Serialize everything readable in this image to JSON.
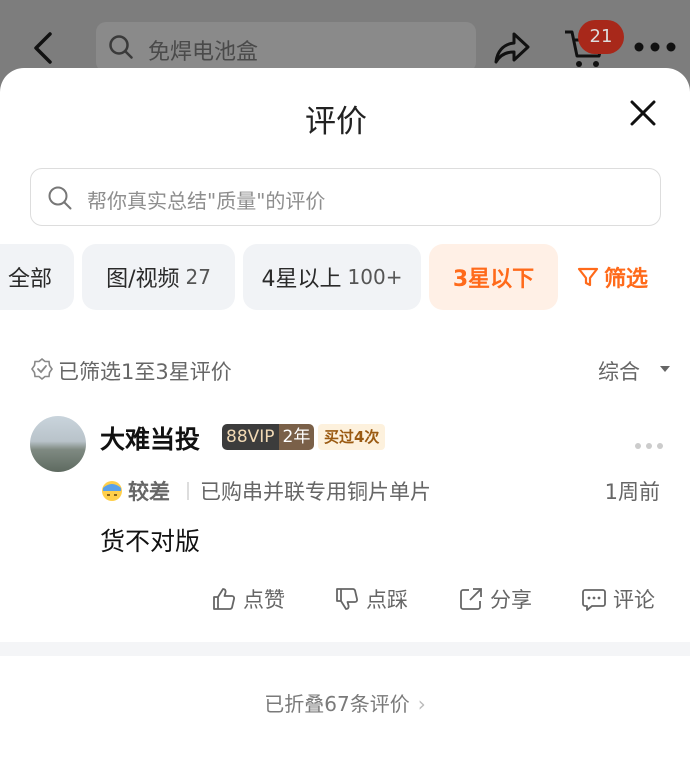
{
  "topbar": {
    "search_text": "免焊电池盒",
    "cart_count": "21"
  },
  "sheet": {
    "title": "评价",
    "search_placeholder": "帮你真实总结\"质量\"的评价"
  },
  "chips": [
    {
      "label": "全部",
      "count": ""
    },
    {
      "label": "图/视频",
      "count": "27"
    },
    {
      "label": "4星以上",
      "count": "100+"
    },
    {
      "label": "3星以下",
      "count": ""
    },
    {
      "label": "筛选",
      "count": ""
    }
  ],
  "filter": {
    "text": "已筛选1至3星评价",
    "sort": "综合"
  },
  "review": {
    "username": "大难当投",
    "vip_text": "88VIP",
    "vip_years": "2年",
    "bought": "买过4次",
    "rating": "较差",
    "sku": "已购串并联专用铜片单片",
    "time": "1周前",
    "content": "货不对版",
    "actions": {
      "like": "点赞",
      "dislike": "点踩",
      "share": "分享",
      "comment": "评论"
    }
  },
  "footer": {
    "folded": "已折叠67条评价"
  },
  "colors": {
    "accent": "#ff6a1a",
    "chip_bg": "#f1f3f6",
    "active_chip_bg": "#fff0e6"
  }
}
